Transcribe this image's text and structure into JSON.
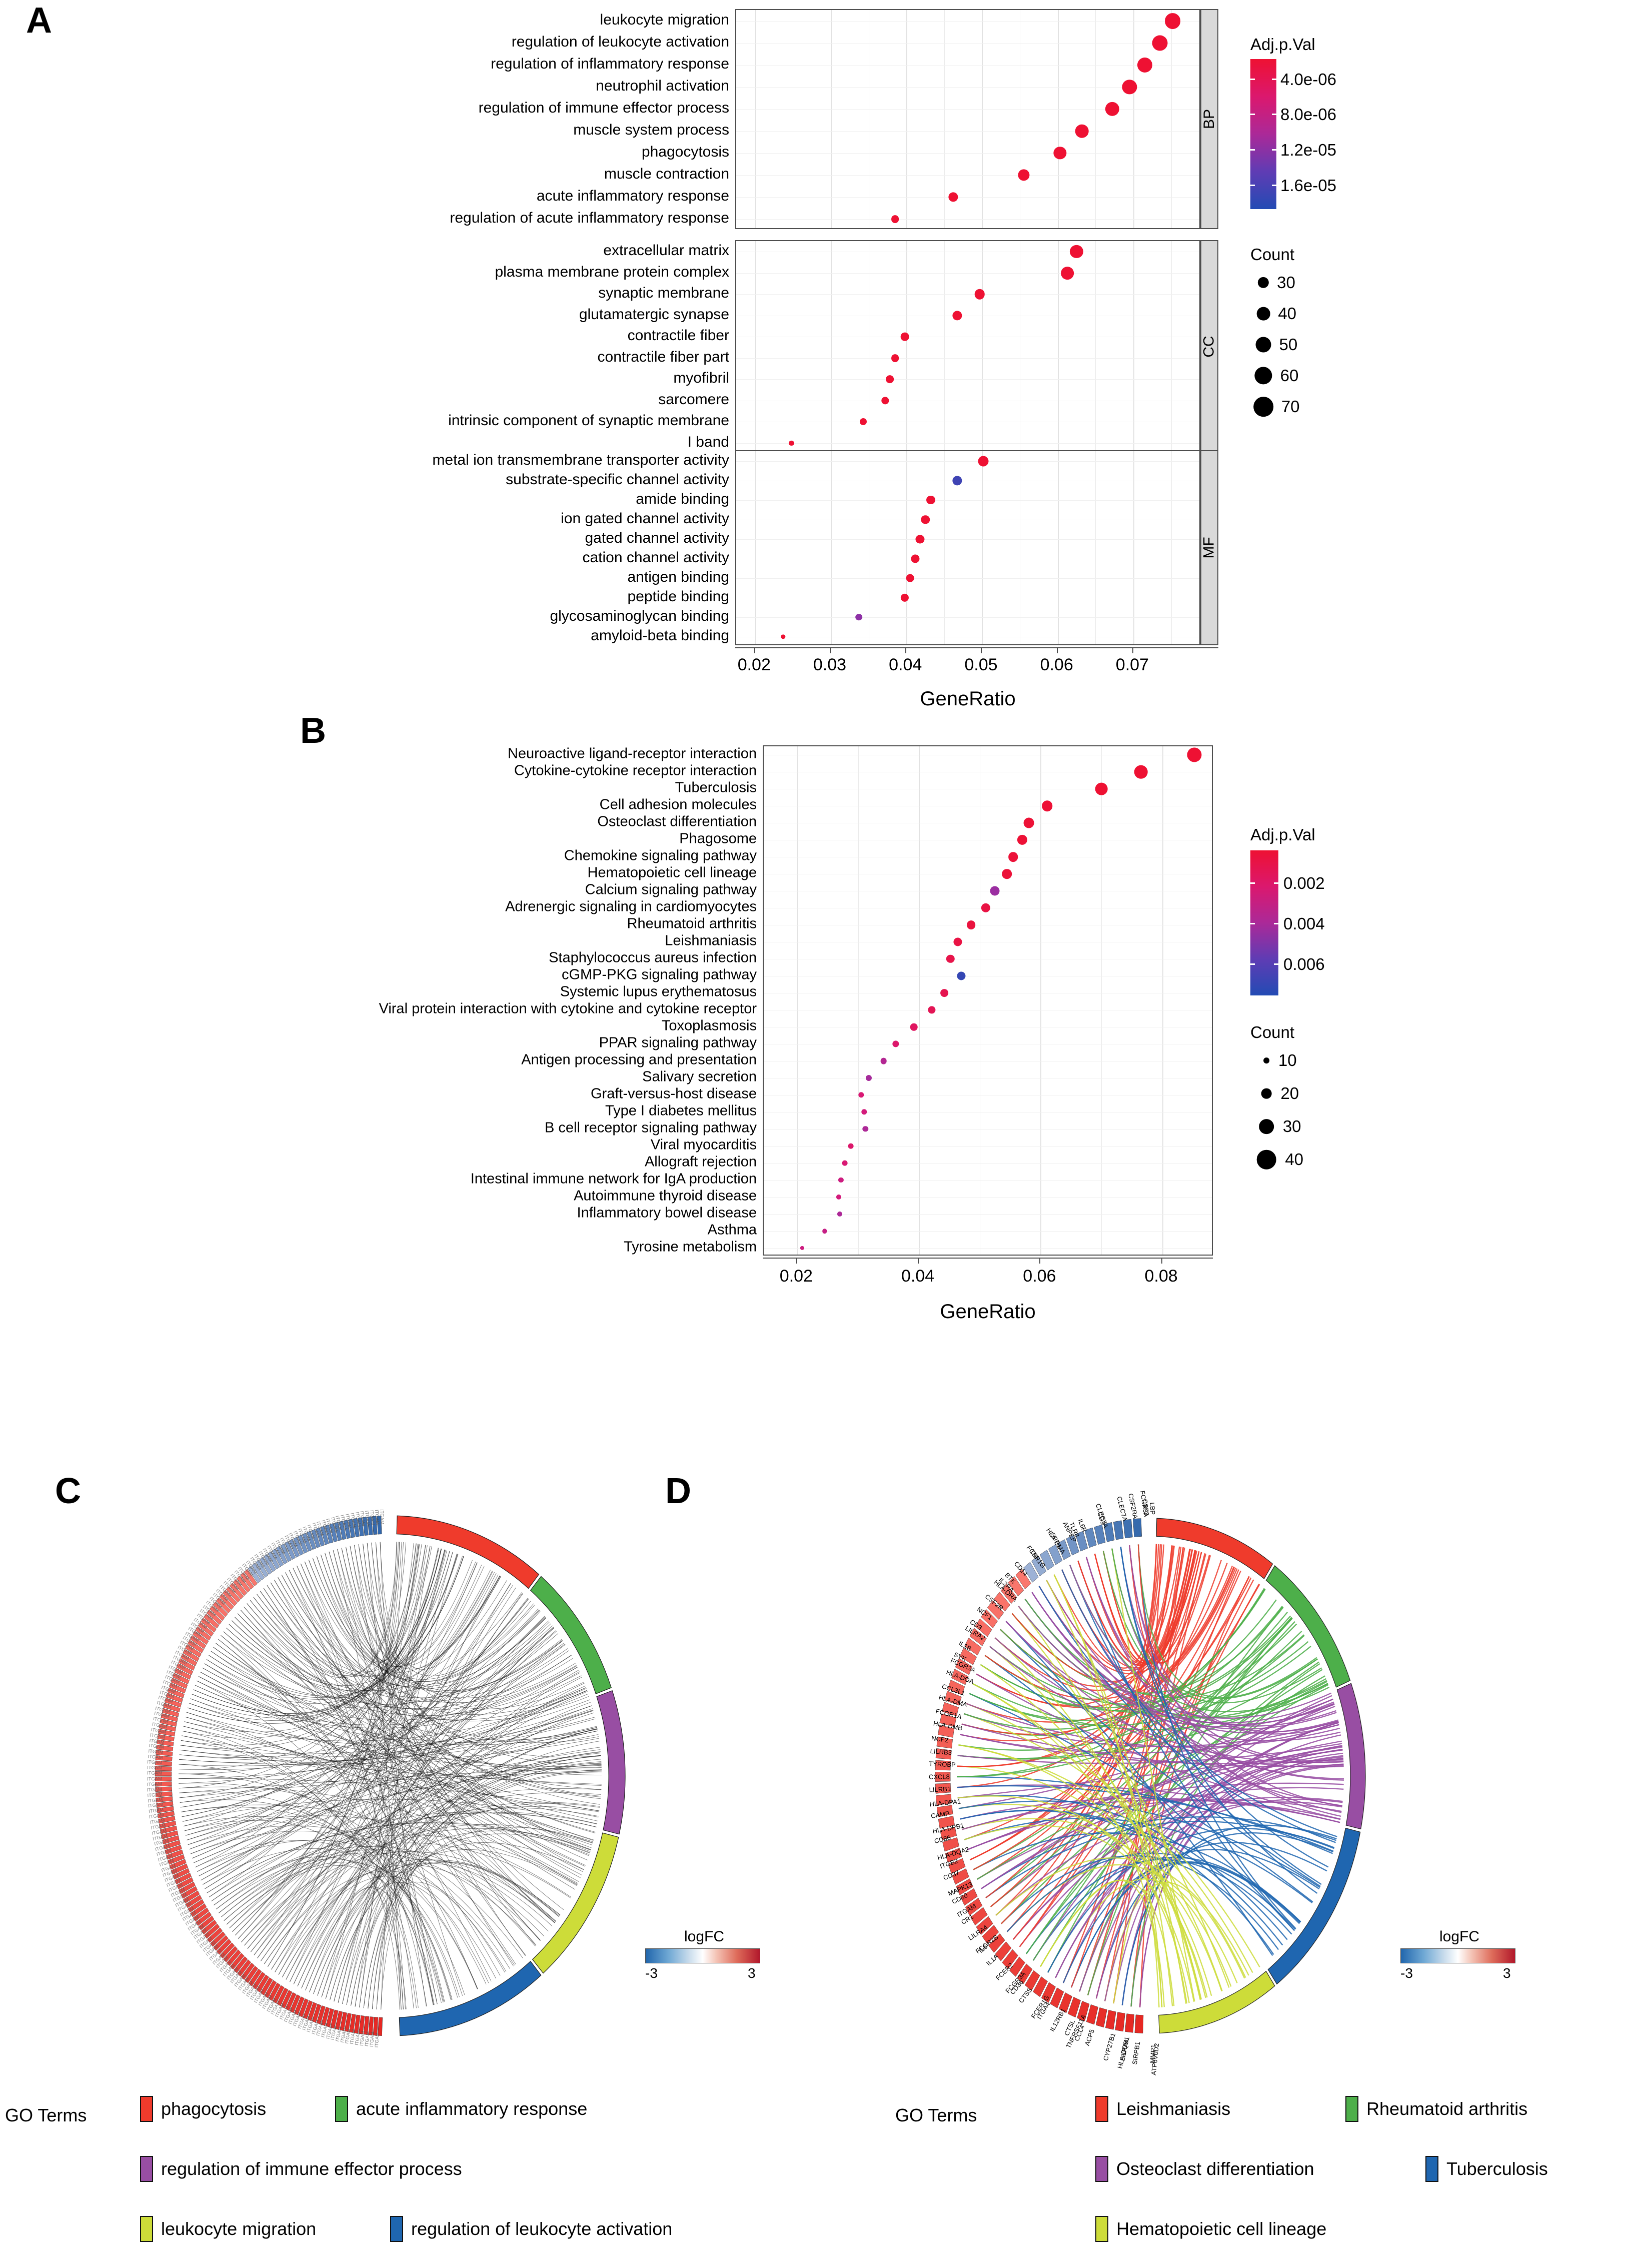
{
  "figure": {
    "panels": [
      {
        "id": "A",
        "letter": "A"
      },
      {
        "id": "B",
        "letter": "B"
      },
      {
        "id": "C",
        "letter": "C"
      },
      {
        "id": "D",
        "letter": "D"
      }
    ]
  },
  "panelA": {
    "letter": "A",
    "xlabel": "GeneRatio",
    "xticks": [
      "0.02",
      "0.03",
      "0.04",
      "0.05",
      "0.06",
      "0.07"
    ],
    "facet_labels": [
      "BP",
      "CC",
      "MF"
    ],
    "legend": {
      "color_title": "Adj.p.Val",
      "color_ticks": [
        "4.0e-06",
        "8.0e-06",
        "1.2e-05",
        "1.6e-05"
      ],
      "size_title": "Count",
      "size_values": [
        "30",
        "40",
        "50",
        "60",
        "70"
      ]
    }
  },
  "panelB": {
    "letter": "B",
    "xlabel": "GeneRatio",
    "xticks": [
      "0.02",
      "0.04",
      "0.06",
      "0.08"
    ],
    "legend": {
      "color_title": "Adj.p.Val",
      "color_ticks": [
        "0.002",
        "0.004",
        "0.006"
      ],
      "size_title": "Count",
      "size_values": [
        "10",
        "20",
        "30",
        "40"
      ]
    }
  },
  "panelC": {
    "letter": "C",
    "logfc_title": "logFC",
    "logfc_min": "-3",
    "logfc_max": "3",
    "go_terms_title": "GO Terms",
    "go_terms": [
      {
        "label": "phagocytosis",
        "color": "#ef3b2c"
      },
      {
        "label": "acute inflammatory response",
        "color": "#4daf4a"
      },
      {
        "label": "regulation of immune effector process",
        "color": "#984ea3"
      },
      {
        "label": "leukocyte migration",
        "color": "#cddc39"
      },
      {
        "label": "regulation of leukocyte activation",
        "color": "#1f66b0"
      }
    ]
  },
  "panelD": {
    "letter": "D",
    "logfc_title": "logFC",
    "logfc_min": "-3",
    "logfc_max": "3",
    "go_terms_title": "GO Terms",
    "go_terms": [
      {
        "label": "Leishmaniasis",
        "color": "#ef3b2c"
      },
      {
        "label": "Rheumatoid arthritis",
        "color": "#4daf4a"
      },
      {
        "label": "Osteoclast differentiation",
        "color": "#984ea3"
      },
      {
        "label": "Tuberculosis",
        "color": "#1f66b0"
      },
      {
        "label": "Hematopoietic cell lineage",
        "color": "#cddc39"
      }
    ],
    "genes": [
      "MMP1",
      "ATP6V0D2",
      "SIRPB1",
      "LILRA4",
      "HLA-DQB1",
      "CYP27B1",
      "ACP5",
      "CCL4",
      "CTSL",
      "TNFRSF11A",
      "IL12RB1",
      "ITGA4",
      "FCER1G",
      "CTSS",
      "CD36",
      "FCGR3A",
      "FCER2",
      "IL1A",
      "IL6",
      "FCGR2B",
      "LILRA4",
      "CR1",
      "ITGAM",
      "CD80",
      "MAPK13",
      "CD37",
      "ITGB2",
      "HLA-DQA2",
      "CD86",
      "HLA-DPB1",
      "CAMP",
      "HLA-DPA1",
      "LILRB1",
      "CXCL8",
      "TYROBP",
      "LILRB3",
      "NCF2",
      "HLA-DMB",
      "FCGR1A",
      "HLA-DMA",
      "CCL3L1",
      "HLA-DOA",
      "FCGR3A",
      "SYK",
      "IL1B",
      "LILRA2",
      "CD3",
      "NCF1",
      "CSF2R",
      "HLA-DRA",
      "IL2RA",
      "BTK",
      "CD14",
      "FCER1G",
      "TNF",
      "HLA-DMA",
      "SPP1",
      "ANPEP",
      "TLR8",
      "IL6R",
      "CLEC7A",
      "CD3",
      "CLEC7A",
      "CSF2RA",
      "FCGR3A",
      "CSF3",
      "LBP"
    ]
  },
  "chart_data": [
    {
      "type": "scatter",
      "id": "panelA",
      "title": "",
      "xlabel": "GeneRatio",
      "ylabel": "",
      "xlim": [
        0.0175,
        0.079
      ],
      "grid": true,
      "legend_position": "right",
      "color_scale": {
        "name": "Adj.p.Val",
        "ticks": [
          4e-06,
          8e-06,
          1.2e-05,
          1.6e-05
        ],
        "low_color": "#ee1133",
        "high_color": "#2b3fb0"
      },
      "size_scale": {
        "name": "Count",
        "values": [
          30,
          40,
          50,
          60,
          70
        ]
      },
      "facets": [
        {
          "name": "BP",
          "categories": [
            "leukocyte migration",
            "regulation of leukocyte activation",
            "regulation of inflammatory response",
            "neutrophil activation",
            "regulation of immune effector process",
            "muscle system process",
            "phagocytosis",
            "muscle contraction",
            "acute inflammatory response",
            "regulation of acute inflammatory response"
          ],
          "generatio": [
            0.0752,
            0.0735,
            0.0715,
            0.0695,
            0.0672,
            0.0632,
            0.0603,
            0.0555,
            0.0462,
            0.0385
          ],
          "count": [
            75,
            73,
            71,
            69,
            67,
            63,
            60,
            55,
            46,
            38
          ],
          "adjpval": [
            1e-06,
            1e-06,
            1e-06,
            1e-06,
            1e-06,
            1e-06,
            1e-06,
            1e-06,
            1e-06,
            1e-06
          ]
        },
        {
          "name": "CC",
          "categories": [
            "extracellular matrix",
            "plasma membrane protein complex",
            "synaptic membrane",
            "glutamatergic synapse",
            "contractile fiber",
            "contractile fiber part",
            "myofibril",
            "sarcomere",
            "intrinsic component of synaptic membrane",
            "I band"
          ],
          "generatio": [
            0.0625,
            0.0613,
            0.0497,
            0.0467,
            0.0398,
            0.0385,
            0.0378,
            0.0372,
            0.0343,
            0.0248
          ],
          "count": [
            62,
            61,
            49,
            46,
            40,
            38,
            38,
            37,
            34,
            25
          ],
          "adjpval": [
            1e-06,
            1e-06,
            1e-06,
            1e-06,
            1e-06,
            1e-06,
            1e-06,
            1e-06,
            1e-06,
            1e-06
          ]
        },
        {
          "name": "MF",
          "categories": [
            "metal ion transmembrane transporter activity",
            "substrate-specific channel activity",
            "amide binding",
            "ion gated channel activity",
            "gated channel activity",
            "cation channel activity",
            "antigen binding",
            "peptide binding",
            "glycosaminoglycan binding",
            "amyloid-beta binding"
          ],
          "generatio": [
            0.0502,
            0.0467,
            0.0432,
            0.0425,
            0.0418,
            0.0412,
            0.0405,
            0.0398,
            0.0337,
            0.0237
          ],
          "count": [
            50,
            46,
            43,
            42,
            41,
            41,
            40,
            39,
            33,
            23
          ],
          "adjpval": [
            1e-06,
            1.55e-05,
            1e-06,
            1e-06,
            1e-06,
            1e-06,
            1e-06,
            1e-06,
            1.15e-05,
            1e-06
          ]
        }
      ]
    },
    {
      "type": "scatter",
      "id": "panelB",
      "title": "",
      "xlabel": "GeneRatio",
      "ylabel": "",
      "xlim": [
        0.0145,
        0.0885
      ],
      "grid": true,
      "legend_position": "right",
      "color_scale": {
        "name": "Adj.p.Val",
        "ticks": [
          0.002,
          0.004,
          0.006
        ],
        "low_color": "#ee1133",
        "high_color": "#2b3fb0"
      },
      "size_scale": {
        "name": "Count",
        "values": [
          10,
          20,
          30,
          40
        ]
      },
      "categories": [
        "Neuroactive ligand-receptor interaction",
        "Cytokine-cytokine receptor interaction",
        "Tuberculosis",
        "Cell adhesion molecules",
        "Osteoclast differentiation",
        "Phagosome",
        "Chemokine signaling pathway",
        "Hematopoietic cell lineage",
        "Calcium signaling pathway",
        "Adrenergic signaling in cardiomyocytes",
        "Rheumatoid arthritis",
        "Leishmaniasis",
        "Staphylococcus aureus infection",
        "cGMP-PKG signaling pathway",
        "Systemic lupus erythematosus",
        "Viral protein interaction with cytokine and cytokine receptor",
        "Toxoplasmosis",
        "PPAR signaling pathway",
        "Antigen processing and presentation",
        "Salivary secretion",
        "Graft-versus-host disease",
        "Type I diabetes mellitus",
        "B cell receptor signaling pathway",
        "Viral myocarditis",
        "Allograft rejection",
        "Intestinal immune network for IgA production",
        "Autoimmune thyroid disease",
        "Inflammatory bowel disease",
        "Asthma",
        "Tyrosine metabolism"
      ],
      "generatio": [
        0.0853,
        0.0765,
        0.07,
        0.0611,
        0.0581,
        0.057,
        0.0555,
        0.0545,
        0.0525,
        0.051,
        0.0486,
        0.0464,
        0.0452,
        0.047,
        0.0442,
        0.0421,
        0.0392,
        0.0362,
        0.0342,
        0.0318,
        0.0305,
        0.031,
        0.0312,
        0.0288,
        0.0278,
        0.0272,
        0.0268,
        0.027,
        0.0245,
        0.0208
      ],
      "count": [
        43,
        39,
        36,
        31,
        30,
        29,
        28,
        28,
        27,
        26,
        25,
        24,
        23,
        24,
        22,
        21,
        20,
        18,
        17,
        16,
        15,
        15,
        15,
        14,
        14,
        13,
        13,
        13,
        12,
        10
      ],
      "adjpval": [
        0.0002,
        0.0002,
        0.0002,
        0.0003,
        0.0003,
        0.0003,
        0.0004,
        0.0004,
        0.0045,
        0.0008,
        0.0006,
        0.0008,
        0.001,
        0.0068,
        0.0012,
        0.0014,
        0.0018,
        0.0022,
        0.0038,
        0.0042,
        0.0025,
        0.0028,
        0.004,
        0.0022,
        0.0025,
        0.003,
        0.0028,
        0.004,
        0.0032,
        0.003
      ]
    }
  ]
}
